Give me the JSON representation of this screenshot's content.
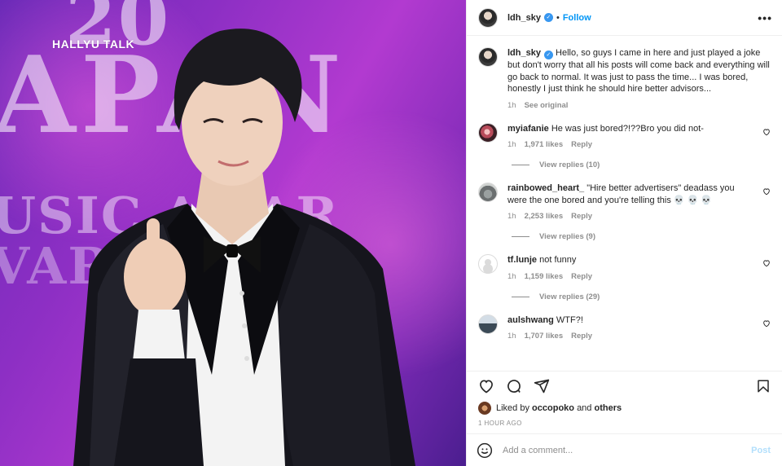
{
  "photo": {
    "watermark": "HALLYU TALK",
    "bg_text_line1": "20",
    "bg_text_line2": "APAN",
    "bg_text_line3": "USIC AWAR",
    "bg_text_line4": "VARD"
  },
  "header": {
    "username": "ldh_sky",
    "dot": "•",
    "follow_label": "Follow",
    "more_label": "•••"
  },
  "caption": {
    "username": "ldh_sky",
    "text": "Hello, so guys I came in here and just played a joke but don't worry that all his posts will come back and everything will go back to normal. It was just to pass the time... I was bored, honestly I just think he should hire better advisors...",
    "time": "1h",
    "see_original": "See original"
  },
  "comments": [
    {
      "username": "myiafanie",
      "text": "He was just bored?!??Bro you did not-",
      "time": "1h",
      "likes": "1,971 likes",
      "reply": "Reply",
      "view_replies": "View replies (10)"
    },
    {
      "username": "rainbowed_heart_",
      "text": "\"Hire better advertisers\" deadass you were the one bored and you're telling this 💀 💀 💀",
      "time": "1h",
      "likes": "2,253 likes",
      "reply": "Reply",
      "view_replies": "View replies (9)"
    },
    {
      "username": "tf.lunje",
      "text": "not funny",
      "time": "1h",
      "likes": "1,159 likes",
      "reply": "Reply",
      "view_replies": "View replies (29)"
    },
    {
      "username": "aulshwang",
      "text": "WTF?!",
      "time": "1h",
      "likes": "1,707 likes",
      "reply": "Reply"
    }
  ],
  "liked": {
    "prefix": "Liked by",
    "user": "occopoko",
    "and": "and",
    "others": "others"
  },
  "post_time": "1 HOUR AGO",
  "add_comment": {
    "placeholder": "Add a comment...",
    "post_label": "Post"
  },
  "colors": {
    "accent": "#0095f6",
    "post_disabled": "#b2dffc",
    "secondary_text": "#8e8e8e"
  }
}
